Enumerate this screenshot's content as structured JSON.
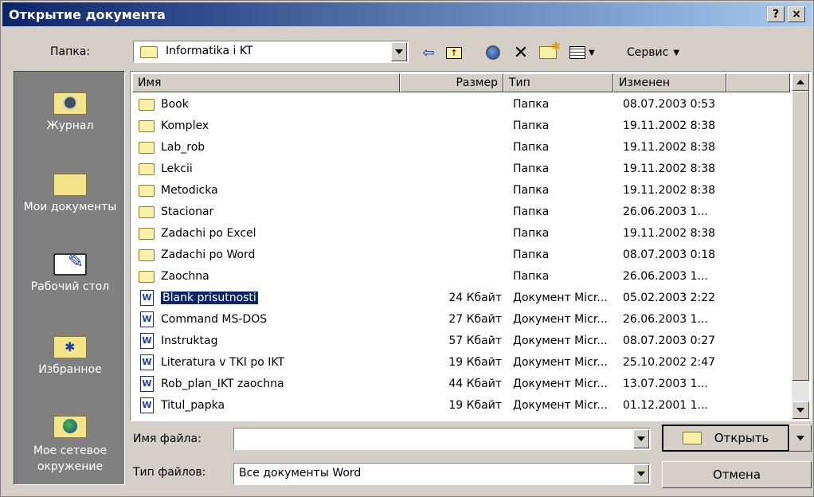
{
  "window": {
    "title": "Открытие документа",
    "help": "?",
    "close": "×"
  },
  "folder": {
    "label": "Папка:",
    "value": "Informatika i KT"
  },
  "toolbar": {
    "service_label": "Сервис"
  },
  "places": [
    {
      "label": "Журнал"
    },
    {
      "label": "Мои документы"
    },
    {
      "label": "Рабочий стол"
    },
    {
      "label": "Избранное"
    },
    {
      "label": "Мое сетевое окружение"
    }
  ],
  "columns": {
    "name": "Имя",
    "size": "Размер",
    "type": "Тип",
    "modified": "Изменен"
  },
  "files": [
    {
      "name": "Book",
      "size": "",
      "type": "Папка",
      "modified": "08.07.2003 0:53",
      "kind": "folder"
    },
    {
      "name": "Komplex",
      "size": "",
      "type": "Папка",
      "modified": "19.11.2002 8:38",
      "kind": "folder"
    },
    {
      "name": "Lab_rob",
      "size": "",
      "type": "Папка",
      "modified": "19.11.2002 8:38",
      "kind": "folder"
    },
    {
      "name": "Lekcii",
      "size": "",
      "type": "Папка",
      "modified": "19.11.2002 8:38",
      "kind": "folder"
    },
    {
      "name": "Metodicka",
      "size": "",
      "type": "Папка",
      "modified": "19.11.2002 8:38",
      "kind": "folder"
    },
    {
      "name": "Stacionar",
      "size": "",
      "type": "Папка",
      "modified": "26.06.2003 1...",
      "kind": "folder"
    },
    {
      "name": "Zadachi po Excel",
      "size": "",
      "type": "Папка",
      "modified": "19.11.2002 8:38",
      "kind": "folder"
    },
    {
      "name": "Zadachi po Word",
      "size": "",
      "type": "Папка",
      "modified": "08.07.2003 0:18",
      "kind": "folder"
    },
    {
      "name": "Zaochna",
      "size": "",
      "type": "Папка",
      "modified": "26.06.2003 1...",
      "kind": "folder"
    },
    {
      "name": "Blank prisutnosti",
      "size": "24 Кбайт",
      "type": "Документ Micr...",
      "modified": "05.02.2003 2:22",
      "kind": "doc",
      "selected": true
    },
    {
      "name": "Command MS-DOS",
      "size": "27 Кбайт",
      "type": "Документ Micr...",
      "modified": "26.06.2003 1...",
      "kind": "doc"
    },
    {
      "name": "Instruktag",
      "size": "57 Кбайт",
      "type": "Документ Micr...",
      "modified": "08.07.2003 0:27",
      "kind": "doc"
    },
    {
      "name": "Literatura v TKI po IKT",
      "size": "19 Кбайт",
      "type": "Документ Micr...",
      "modified": "25.10.2002 2:47",
      "kind": "doc"
    },
    {
      "name": "Rob_plan_IKT zaochna",
      "size": "44 Кбайт",
      "type": "Документ Micr...",
      "modified": "13.07.2003 1...",
      "kind": "doc"
    },
    {
      "name": "Titul_papka",
      "size": "19 Кбайт",
      "type": "Документ Micr...",
      "modified": "01.12.2001 1...",
      "kind": "doc"
    }
  ],
  "filename": {
    "label": "Имя файла:",
    "value": ""
  },
  "filetype": {
    "label": "Тип файлов:",
    "value": "Все документы Word"
  },
  "buttons": {
    "open": "Открыть",
    "cancel": "Отмена"
  }
}
